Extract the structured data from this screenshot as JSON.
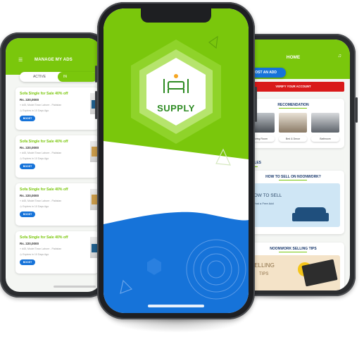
{
  "center": {
    "logo_text": "SUPPLY",
    "logo_icon": "furniture-logo-icon"
  },
  "left": {
    "title": "MANAGE MY ADS",
    "tab_active": "ACTIVE",
    "tab_other": "IN",
    "ads": [
      {
        "title": "Sofa Single for Sale 40% off",
        "price": "Rs. 220,0000",
        "location": "d45, Model Town Lahore - Pakistan",
        "expires": "Expires in 10 Days Ago",
        "button": "BOOST"
      },
      {
        "title": "Sofa Single for Sale 40% off",
        "price": "Rs. 220,0000",
        "location": "d45, Model Town Lahore - Pakistan",
        "expires": "Expires in 10 Days Ago",
        "button": "BOOST"
      },
      {
        "title": "Sofa Single for Sale 40% off",
        "price": "Rs. 220,0000",
        "location": "d45, Model Town Lahore - Pakistan",
        "expires": "Expires in 10 Days Ago",
        "button": "BOOST"
      },
      {
        "title": "Sofa Single for Sale 40% off",
        "price": "Rs. 220,0000",
        "location": "d45, Model Town Lahore - Pakistan",
        "expires": "Expires in 10 Days Ago",
        "button": "BOOST"
      }
    ]
  },
  "right": {
    "title": "HOME",
    "post_button": "POST AN ADD",
    "verify_button": "VERIFY YOUR ACCOUNT",
    "recommendation_title": "RECOMENDATION",
    "rec_items": [
      {
        "label": "Living Room"
      },
      {
        "label": "Bed & Decor"
      },
      {
        "label": "Bathroom"
      }
    ],
    "articles_label": "ARTICLES",
    "article1_heading": "HOW TO SELL ON NOONWORK?",
    "article1_banner_title": "HOW TO SELL",
    "article1_banner_sub": "Post a Free Add",
    "article2_heading": "NOONWORK SELLING TIPS",
    "article2_banner_title": "SELLING",
    "article2_banner_sub": "TIPS"
  },
  "colors": {
    "green": "#7ac70c",
    "blue": "#1673d9",
    "red": "#d91a1a",
    "navy": "#1a3a6e"
  }
}
